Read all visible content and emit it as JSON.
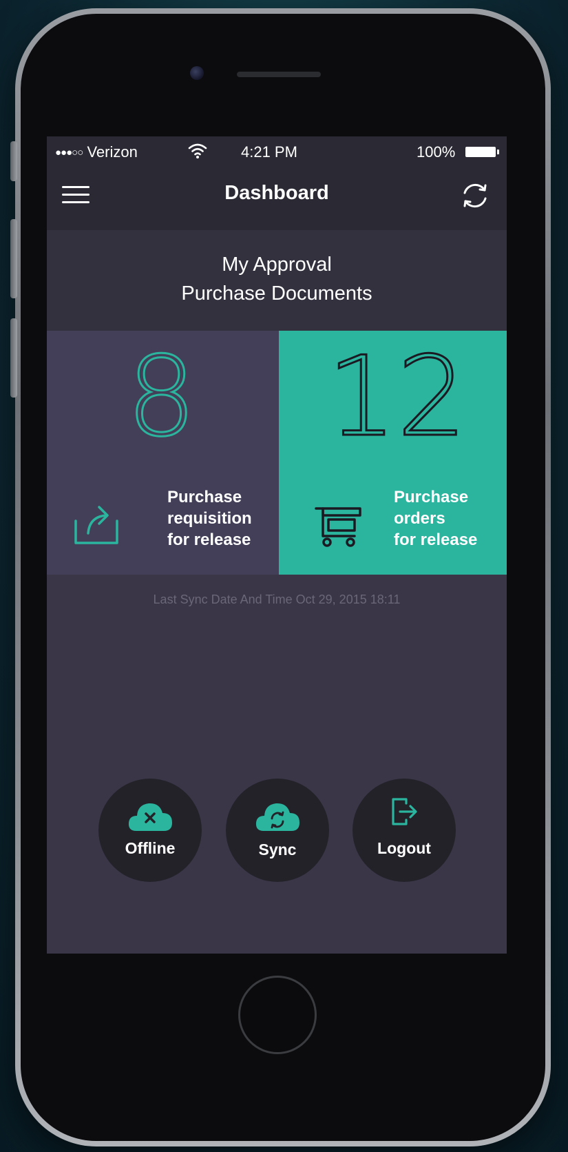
{
  "status_bar": {
    "signal": "●●●○○",
    "carrier": "Verizon",
    "time": "4:21 PM",
    "battery": "100%"
  },
  "nav": {
    "title": "Dashboard",
    "menu_icon": "hamburger-menu-icon",
    "refresh_icon": "refresh-icon"
  },
  "header": {
    "line1": "My Approval",
    "line2": "Purchase Documents"
  },
  "tiles": [
    {
      "count": "8",
      "label_lines": [
        "Purchase",
        "requisition",
        "for release"
      ],
      "icon": "share-icon"
    },
    {
      "count": "12",
      "label_lines": [
        "Purchase",
        "orders",
        "for release"
      ],
      "icon": "shopping-cart-icon"
    }
  ],
  "last_sync": "Last Sync Date And Time Oct 29, 2015 18:11",
  "actions": [
    {
      "label": "Offline",
      "icon": "cloud-offline-icon"
    },
    {
      "label": "Sync",
      "icon": "cloud-sync-icon"
    },
    {
      "label": "Logout",
      "icon": "logout-icon"
    }
  ],
  "colors": {
    "accent": "#2bb59f",
    "bar": "#2b2a34",
    "header": "#34313f",
    "background": "#3a3648",
    "tile_left": "#433f58",
    "button_circle": "#232229",
    "muted_text": "#6a6778"
  }
}
